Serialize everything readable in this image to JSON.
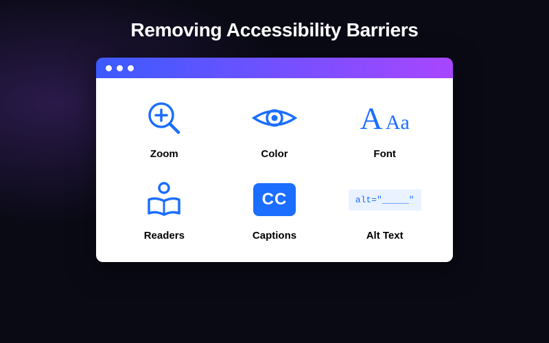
{
  "title": "Removing Accessibility Barriers",
  "colors": {
    "accent": "#1b6eff",
    "gradient_start": "#3b5bff",
    "gradient_end": "#a846ff"
  },
  "features": {
    "zoom": {
      "label": "Zoom",
      "icon": "magnify-plus-icon"
    },
    "color": {
      "label": "Color",
      "icon": "eye-icon"
    },
    "font": {
      "label": "Font",
      "icon": "font-size-icon",
      "glyph_big": "A",
      "glyph_small": "Aa"
    },
    "readers": {
      "label": "Readers",
      "icon": "reader-icon"
    },
    "captions": {
      "label": "Captions",
      "icon": "cc-icon",
      "cc_text": "CC"
    },
    "alttext": {
      "label": "Alt Text",
      "icon": "alt-text-icon",
      "code": "alt=\"_____\""
    }
  }
}
